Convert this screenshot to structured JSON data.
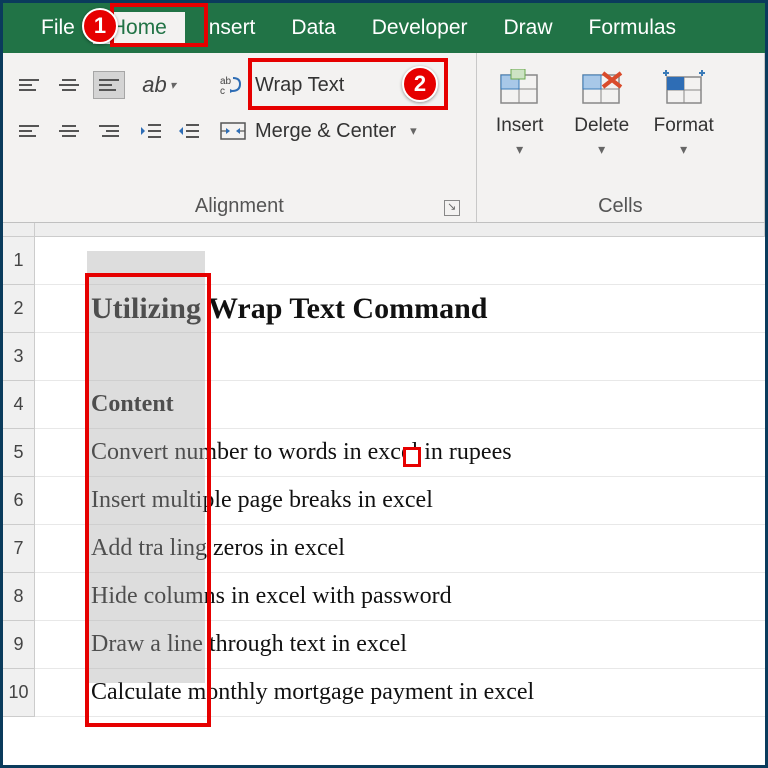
{
  "tabs": {
    "file": "File",
    "home": "Home",
    "insert": "Insert",
    "data": "Data",
    "developer": "Developer",
    "draw": "Draw",
    "formulas": "Formulas"
  },
  "ribbon": {
    "alignment_label": "Alignment",
    "cells_label": "Cells",
    "wrap_text": "Wrap Text",
    "merge_center": "Merge & Center",
    "insert": "Insert",
    "delete": "Delete",
    "format": "Format"
  },
  "callouts": {
    "one": "1",
    "two": "2"
  },
  "rows": {
    "r1": "1",
    "r2": "2",
    "r3": "3",
    "r4": "4",
    "r5": "5",
    "r6": "6",
    "r7": "7",
    "r8": "8",
    "r9": "9",
    "r10": "10"
  },
  "sheet": {
    "title": "Utilizing Wrap Text Command",
    "r4": "Content",
    "r5": "Convert number to words in excel in rupees",
    "r6": "Insert multiple page breaks in excel",
    "r7": "Add tra ling zeros in excel",
    "r8": "Hide columns in excel with password",
    "r9": "Draw a line through text in excel",
    "r10": "Calculate monthly mortgage payment in excel"
  }
}
